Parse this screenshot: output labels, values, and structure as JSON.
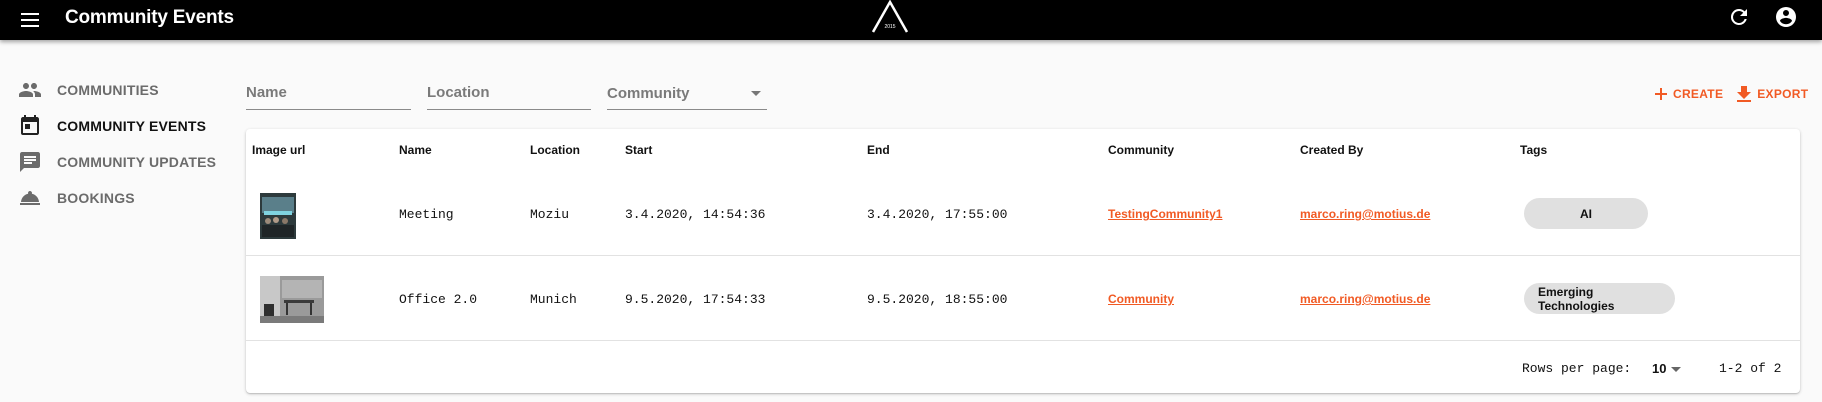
{
  "appbar": {
    "title": "Community Events",
    "logo_text": "2015",
    "icons": {
      "menu": "menu-icon",
      "refresh": "refresh-icon",
      "account": "account-circle-icon"
    }
  },
  "sidebar": {
    "items": [
      {
        "label": "COMMUNITIES",
        "icon": "people-icon",
        "active": false
      },
      {
        "label": "COMMUNITY EVENTS",
        "icon": "calendar-icon",
        "active": true
      },
      {
        "label": "COMMUNITY UPDATES",
        "icon": "chat-icon",
        "active": false
      },
      {
        "label": "BOOKINGS",
        "icon": "room-service-icon",
        "active": false
      }
    ]
  },
  "filters": {
    "name_placeholder": "Name",
    "location_placeholder": "Location",
    "community_placeholder": "Community"
  },
  "actions": {
    "create_label": "CREATE",
    "export_label": "EXPORT"
  },
  "table": {
    "headers": {
      "image": "Image url",
      "name": "Name",
      "location": "Location",
      "start": "Start",
      "end": "End",
      "community": "Community",
      "created_by": "Created By",
      "tags": "Tags"
    },
    "rows": [
      {
        "name": "Meeting",
        "location": "Moziu",
        "start": "3.4.2020, 14:54:36",
        "end": "3.4.2020, 17:55:00",
        "community": "TestingCommunity1",
        "created_by": "marco.ring@motius.de",
        "tags": [
          "AI"
        ]
      },
      {
        "name": "Office 2.0",
        "location": "Munich",
        "start": "9.5.2020, 17:54:33",
        "end": "9.5.2020, 18:55:00",
        "community": "Community",
        "created_by": "marco.ring@motius.de",
        "tags": [
          "Emerging Technologies"
        ]
      }
    ]
  },
  "pagination": {
    "rows_per_page_label": "Rows per page:",
    "rows_per_page": "10",
    "range": "1-2 of 2"
  },
  "colors": {
    "accent": "#f15a24",
    "appbar": "#000000",
    "chip": "#e0e0e0"
  }
}
